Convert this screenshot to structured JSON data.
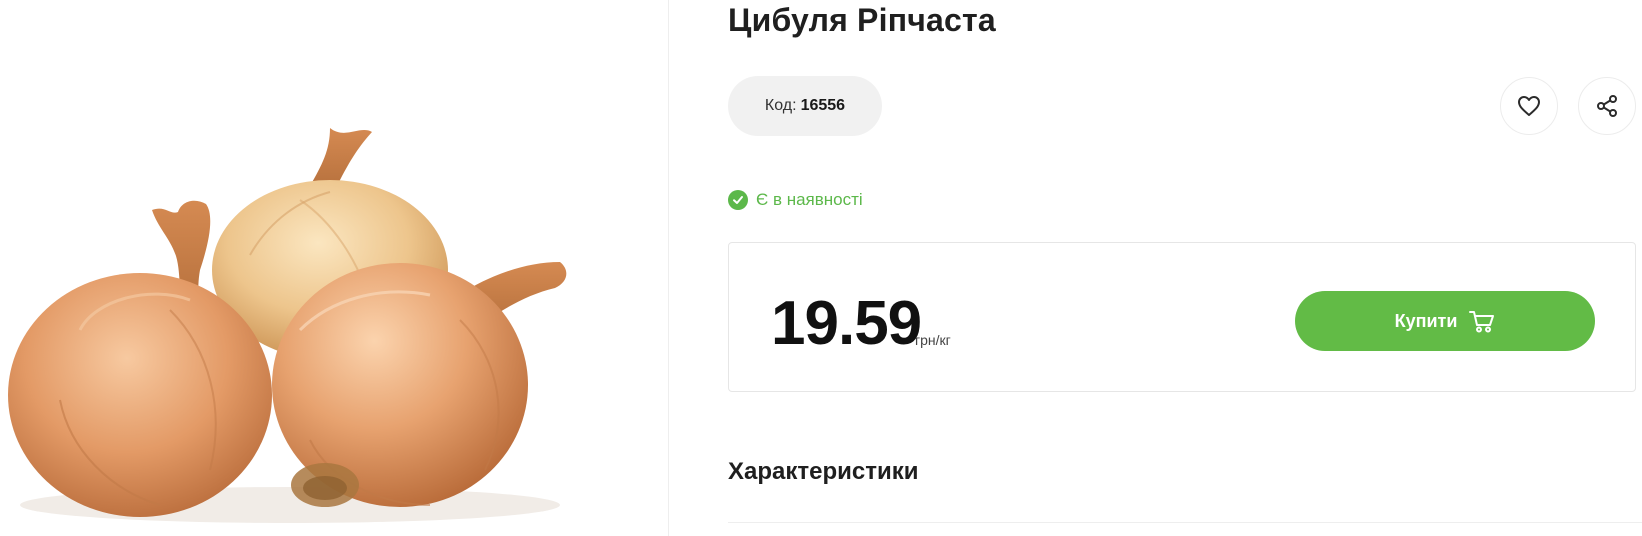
{
  "product": {
    "title": "Цибуля Ріпчаста",
    "code_label": "Код:",
    "code_value": "16556",
    "stock_text": "Є в наявності",
    "price": "19.59",
    "unit": "грн/кг",
    "buy_label": "Купити"
  },
  "sections": {
    "characteristics_title": "Характеристики"
  },
  "icons": {
    "favorite": "heart-icon",
    "share": "share-icon",
    "stock": "check-circle-icon",
    "cart": "cart-icon"
  },
  "colors": {
    "accent_green": "#62bb46",
    "stock_green": "#5cb84a",
    "onion_skin": "#e09a6a"
  }
}
